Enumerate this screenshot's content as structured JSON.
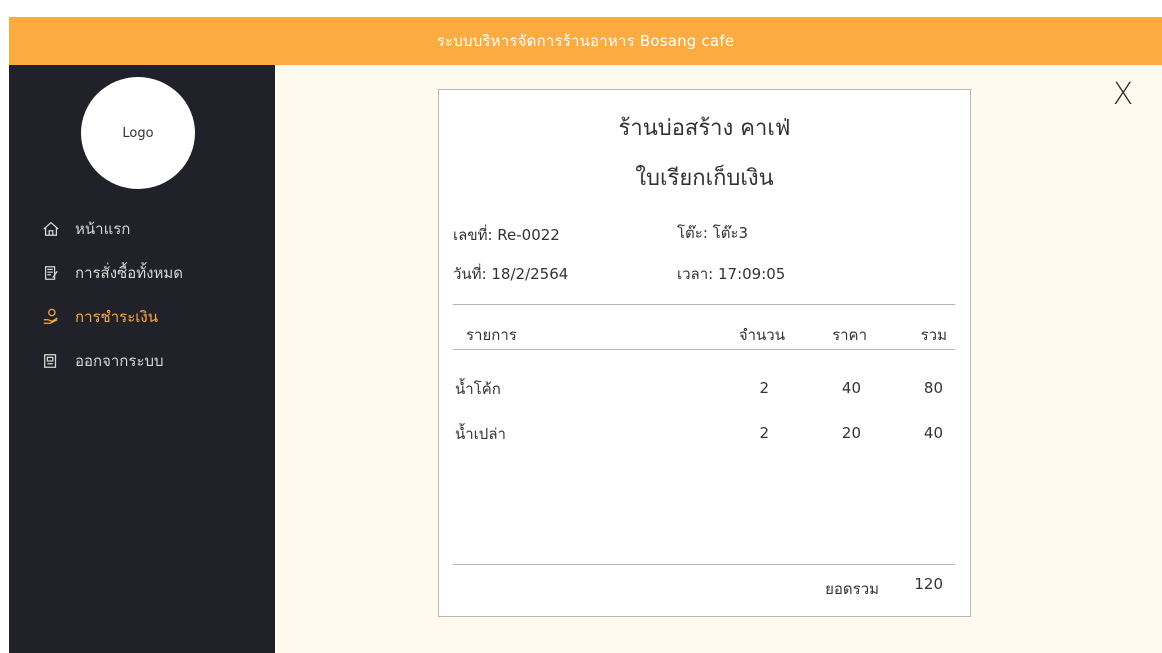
{
  "header": {
    "title": "ระบบบริหารจัดการร้านอาหาร Bosang cafe"
  },
  "sidebar": {
    "logo_text": "Logo",
    "items": [
      {
        "label": "หน้าแรก",
        "icon": "home-icon"
      },
      {
        "label": "การสั่งซื้อทั้งหมด",
        "icon": "orders-icon"
      },
      {
        "label": "การชำระเงิน",
        "icon": "payment-icon",
        "active": true
      },
      {
        "label": "ออกจากระบบ",
        "icon": "logout-icon"
      }
    ]
  },
  "close_label": "X",
  "receipt": {
    "shop_name": "ร้านบ่อสร้าง คาเฟ่",
    "doc_title": "ใบเรียกเก็บเงิน",
    "number": "เลขที่: Re-0022",
    "table": "โต๊ะ: โต๊ะ3",
    "date": "วันที่: 18/2/2564",
    "time": "เวลา: 17:09:05",
    "columns": [
      "รายการ",
      "จำนวน",
      "ราคา",
      "รวม"
    ],
    "rows": [
      {
        "item": "น้ำโค้ก",
        "qty": "2",
        "price": "40",
        "total": "80"
      },
      {
        "item": "น้ำเปล่า",
        "qty": "2",
        "price": "20",
        "total": "40"
      }
    ],
    "grand_total_label": "ยอดรวม",
    "grand_total": "120"
  },
  "colors": {
    "accent": "#fbab3f",
    "sidebar": "#212129",
    "background": "#fff9ee"
  }
}
